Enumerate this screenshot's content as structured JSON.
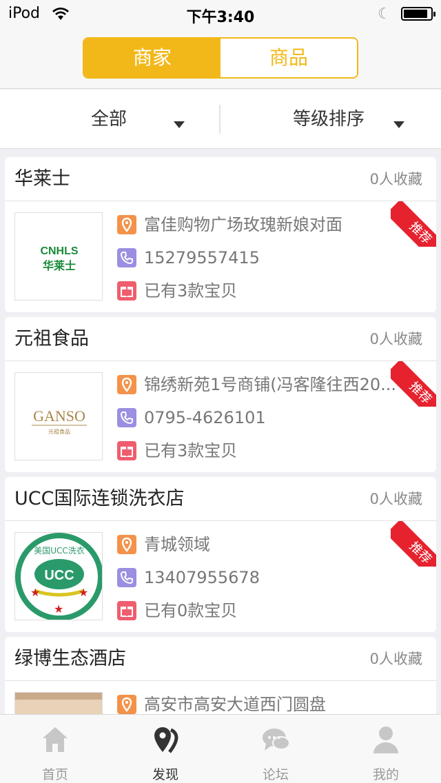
{
  "status_bar": {
    "carrier": "iPod",
    "time": "下午3:40",
    "battery_level": 0.9
  },
  "header": {
    "segments": [
      {
        "label": "商家",
        "active": true
      },
      {
        "label": "商品",
        "active": false
      }
    ],
    "accent_color": "#f2b81a"
  },
  "filter": {
    "category": "全部",
    "sort": "等级排序"
  },
  "stores": [
    {
      "name": "华莱士",
      "favorites": "0人收藏",
      "address": "富佳购物广场玫瑰新娘对面",
      "phone": "15279557415",
      "items": "已有3款宝贝",
      "badge": "推荐",
      "logo_text": "华莱士",
      "logo_sub": "CNHLS"
    },
    {
      "name": "元祖食品",
      "favorites": "0人收藏",
      "address": "锦绣新苑1号商铺(冯客隆往西20...",
      "phone": "0795-4626101",
      "items": "已有3款宝贝",
      "badge": "推荐",
      "logo_text": "GANSO",
      "logo_sub": "元祖食品"
    },
    {
      "name": "UCC国际连锁洗衣店",
      "favorites": "0人收藏",
      "address": "青城领域",
      "phone": "13407955678",
      "items": "已有0款宝贝",
      "badge": "推荐",
      "logo_text": "UCC",
      "logo_sub": "美国UCC洗衣"
    },
    {
      "name": "绿博生态酒店",
      "favorites": "0人收藏",
      "address": "高安市高安大道西门圆盘",
      "phone": "",
      "items": "",
      "badge": "",
      "logo_text": "",
      "logo_sub": ""
    }
  ],
  "tabbar": {
    "tabs": [
      {
        "label": "首页",
        "icon": "home-icon"
      },
      {
        "label": "发现",
        "icon": "location-discover-icon",
        "active": true
      },
      {
        "label": "论坛",
        "icon": "chat-icon"
      },
      {
        "label": "我的",
        "icon": "user-icon"
      }
    ]
  }
}
